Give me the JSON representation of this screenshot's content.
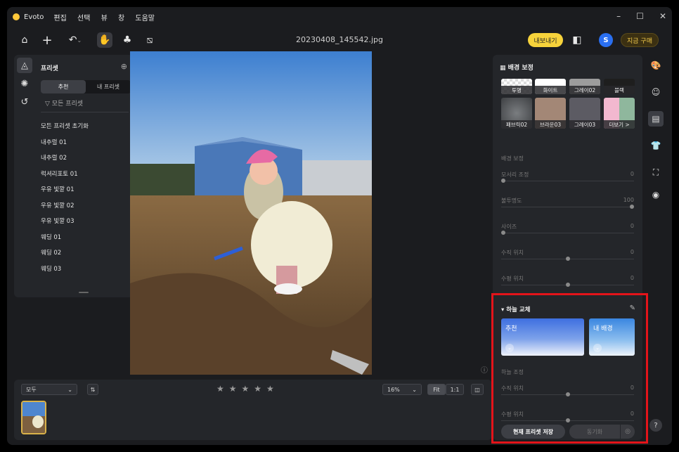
{
  "app": {
    "name": "Evoto",
    "menu": [
      "편집",
      "선택",
      "뷰",
      "창",
      "도움말"
    ]
  },
  "window_controls": [
    "–",
    "☐",
    "✕"
  ],
  "toolbar": {
    "filename": "20230408_145542.jpg",
    "export_label": "내보내기",
    "avatar_letter": "S",
    "buy_label": "지금 구매"
  },
  "presets": {
    "title": "프리셋",
    "tabs": [
      "추천",
      "내 프리셋"
    ],
    "filter_label": "모든 프리셋",
    "items": [
      "모든 프리셋 초기화",
      "내추럴 01",
      "내추럴 02",
      "럭셔리포토 01",
      "우유 빛깔 01",
      "우유 빛깔 02",
      "우유 빛깔 03",
      "웨딩 01",
      "웨딩 02",
      "웨딩 03"
    ]
  },
  "bottom": {
    "filter_value": "모두",
    "zoom_value": "16%",
    "fit_label": "Fit",
    "one_label": "1:1",
    "rating": 0
  },
  "right_panel": {
    "bg_title": "배경 보정",
    "bg_top": [
      "투명",
      "화이트",
      "그레이02",
      "블랙"
    ],
    "bg_tiles": [
      "패브릭02",
      "브라운03",
      "그레이03",
      "더보기 >"
    ],
    "bg_section": "배경 보정",
    "bg_sliders": [
      {
        "label": "모서리 조정",
        "value": "0",
        "pos": 0.0
      },
      {
        "label": "불투명도",
        "value": "100",
        "pos": 1.0
      },
      {
        "label": "사이즈",
        "value": "0",
        "pos": 0.0
      },
      {
        "label": "수직 위치",
        "value": "0",
        "pos": 0.5
      },
      {
        "label": "수평 위치",
        "value": "0",
        "pos": 0.5
      }
    ],
    "sky_title": "하늘 교체",
    "sky_cards": [
      "추천",
      "내 배경"
    ],
    "sky_section": "하늘 조정",
    "sky_sliders": [
      {
        "label": "수직 위치",
        "value": "0",
        "pos": 0.5
      },
      {
        "label": "수평 위치",
        "value": "0",
        "pos": 0.5
      }
    ],
    "save_label": "현재 프리셋 저장",
    "sync_label": "동기화"
  },
  "help_label": "?"
}
